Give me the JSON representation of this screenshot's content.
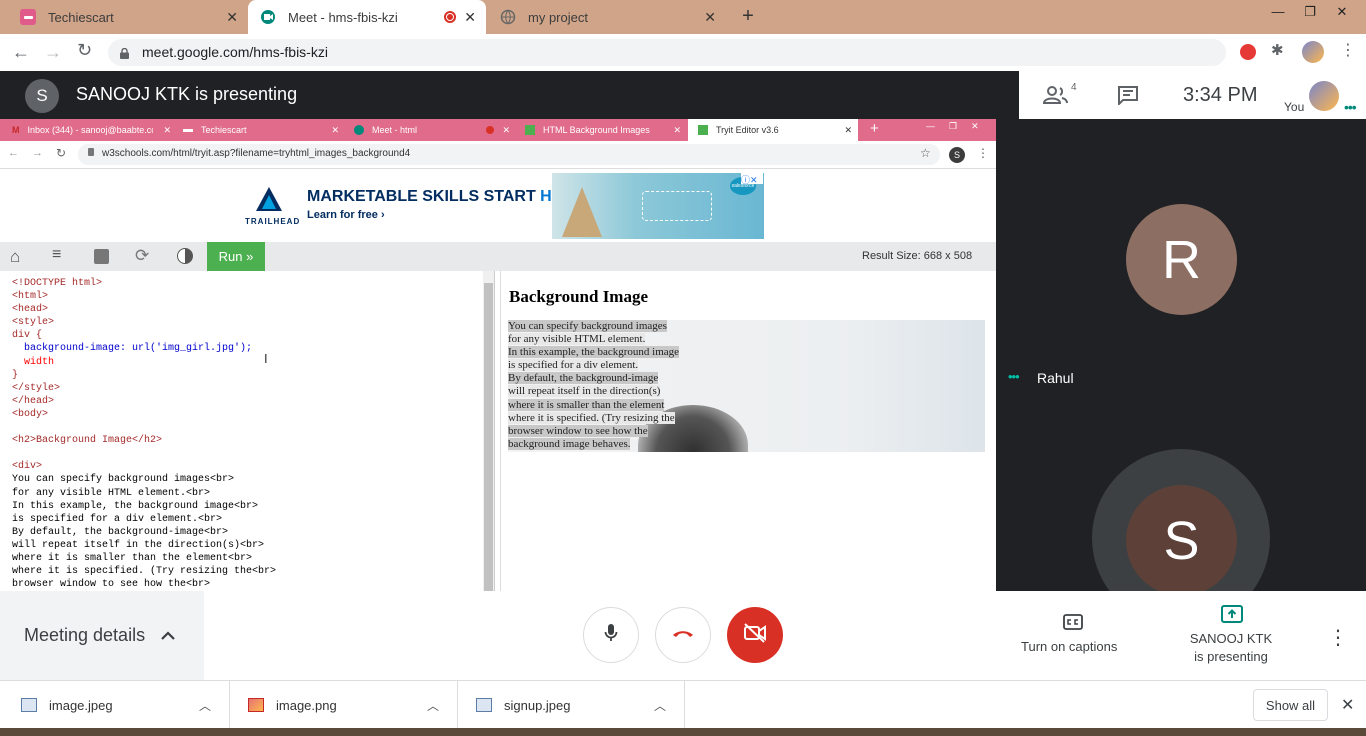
{
  "browser": {
    "tabs": [
      {
        "title": "Techiescart"
      },
      {
        "title": "Meet - hms-fbis-kzi"
      },
      {
        "title": "my project"
      }
    ],
    "url": "meet.google.com/hms-fbis-kzi"
  },
  "meet": {
    "presenter_initial": "S",
    "presenting_text": "SANOOJ KTK is presenting",
    "participant_count": "4",
    "time": "3:34 PM",
    "you_label": "You",
    "tiles": [
      {
        "initial": "R",
        "name": "Rahul",
        "color": "#8d6e63"
      },
      {
        "initial": "S",
        "color": "#5d4037"
      }
    ],
    "meeting_details": "Meeting details",
    "captions_label": "Turn on captions",
    "presenting_line1": "SANOOJ KTK",
    "presenting_line2": "is presenting"
  },
  "inner": {
    "tabs": [
      {
        "title": "Inbox (344) - sanooj@baabte.co"
      },
      {
        "title": "Techiescart"
      },
      {
        "title": "Meet - html"
      },
      {
        "title": "HTML Background Images"
      },
      {
        "title": "Tryit Editor v3.6"
      }
    ],
    "url": "w3schools.com/html/tryit.asp?filename=tryhtml_images_background4",
    "profile_initial": "S",
    "ad": {
      "brand": "TRAILHEAD",
      "headline_main": "MARKETABLE SKILLS START ",
      "headline_accent": "HERE.",
      "sub": "Learn for free ›",
      "sponsor": "salesforce"
    },
    "run_label": "Run »",
    "result_size": "Result Size: 668 x 508",
    "code_lines": [
      "<!DOCTYPE html>",
      "<html>",
      "<head>",
      "<style>",
      "div {",
      "  background-image: url('img_girl.jpg');",
      "  width",
      "}",
      "</style>",
      "</head>",
      "<body>",
      "",
      "<h2>Background Image</h2>",
      "",
      "<div>",
      "You can specify background images<br>",
      "for any visible HTML element.<br>",
      "In this example, the background image<br>",
      "is specified for a div element.<br>",
      "By default, the background-image<br>",
      "will repeat itself in the direction(s)<br>",
      "where it is smaller than the element<br>",
      "where it is specified. (Try resizing the<br>",
      "browser window to see how the<br>"
    ],
    "result_heading": "Background Image",
    "result_lines": [
      "You can specify background images",
      "for any visible HTML element.",
      "In this example, the background image",
      "is specified for a div element.",
      "By default, the background-image",
      "will repeat itself in the direction(s)",
      "where it is smaller than the element",
      "where it is specified. (Try resizing the",
      "browser window to see how the",
      "background image behaves."
    ]
  },
  "downloads": {
    "items": [
      {
        "name": "image.jpeg"
      },
      {
        "name": "image.png"
      },
      {
        "name": "signup.jpeg"
      }
    ],
    "show_all": "Show all"
  },
  "colors": {
    "titlebar": "#cfa488",
    "meet_dark": "#202124",
    "end_call": "#d93025",
    "run_green": "#4caf50",
    "inner_tabbar": "#e06b8b"
  }
}
